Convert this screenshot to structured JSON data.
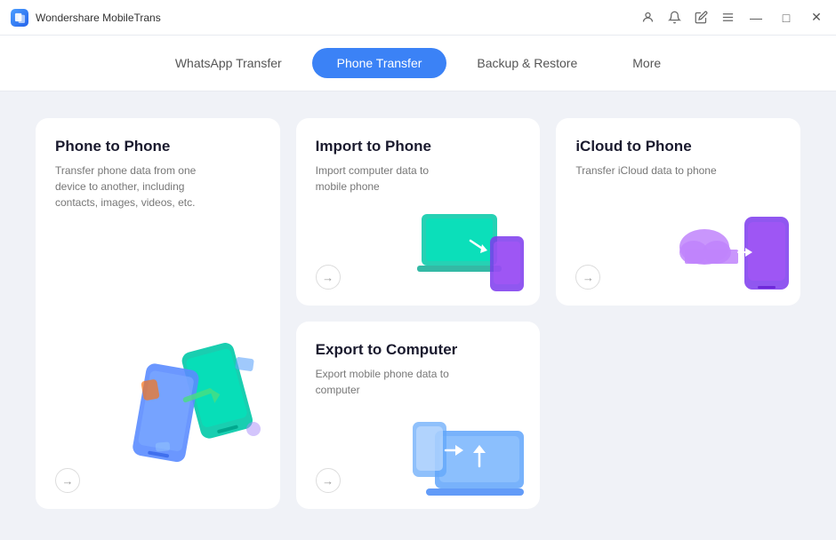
{
  "app": {
    "title": "Wondershare MobileTrans"
  },
  "nav": {
    "tabs": [
      {
        "id": "whatsapp",
        "label": "WhatsApp Transfer",
        "active": false
      },
      {
        "id": "phone",
        "label": "Phone Transfer",
        "active": true
      },
      {
        "id": "backup",
        "label": "Backup & Restore",
        "active": false
      },
      {
        "id": "more",
        "label": "More",
        "active": false
      }
    ]
  },
  "cards": [
    {
      "id": "phone-to-phone",
      "title": "Phone to Phone",
      "desc": "Transfer phone data from one device to another, including contacts, images, videos, etc.",
      "large": true
    },
    {
      "id": "import-to-phone",
      "title": "Import to Phone",
      "desc": "Import computer data to mobile phone",
      "large": false
    },
    {
      "id": "icloud-to-phone",
      "title": "iCloud to Phone",
      "desc": "Transfer iCloud data to phone",
      "large": false
    },
    {
      "id": "export-to-computer",
      "title": "Export to Computer",
      "desc": "Export mobile phone data to computer",
      "large": false
    }
  ],
  "window_controls": {
    "minimize": "—",
    "maximize": "□",
    "close": "✕"
  }
}
